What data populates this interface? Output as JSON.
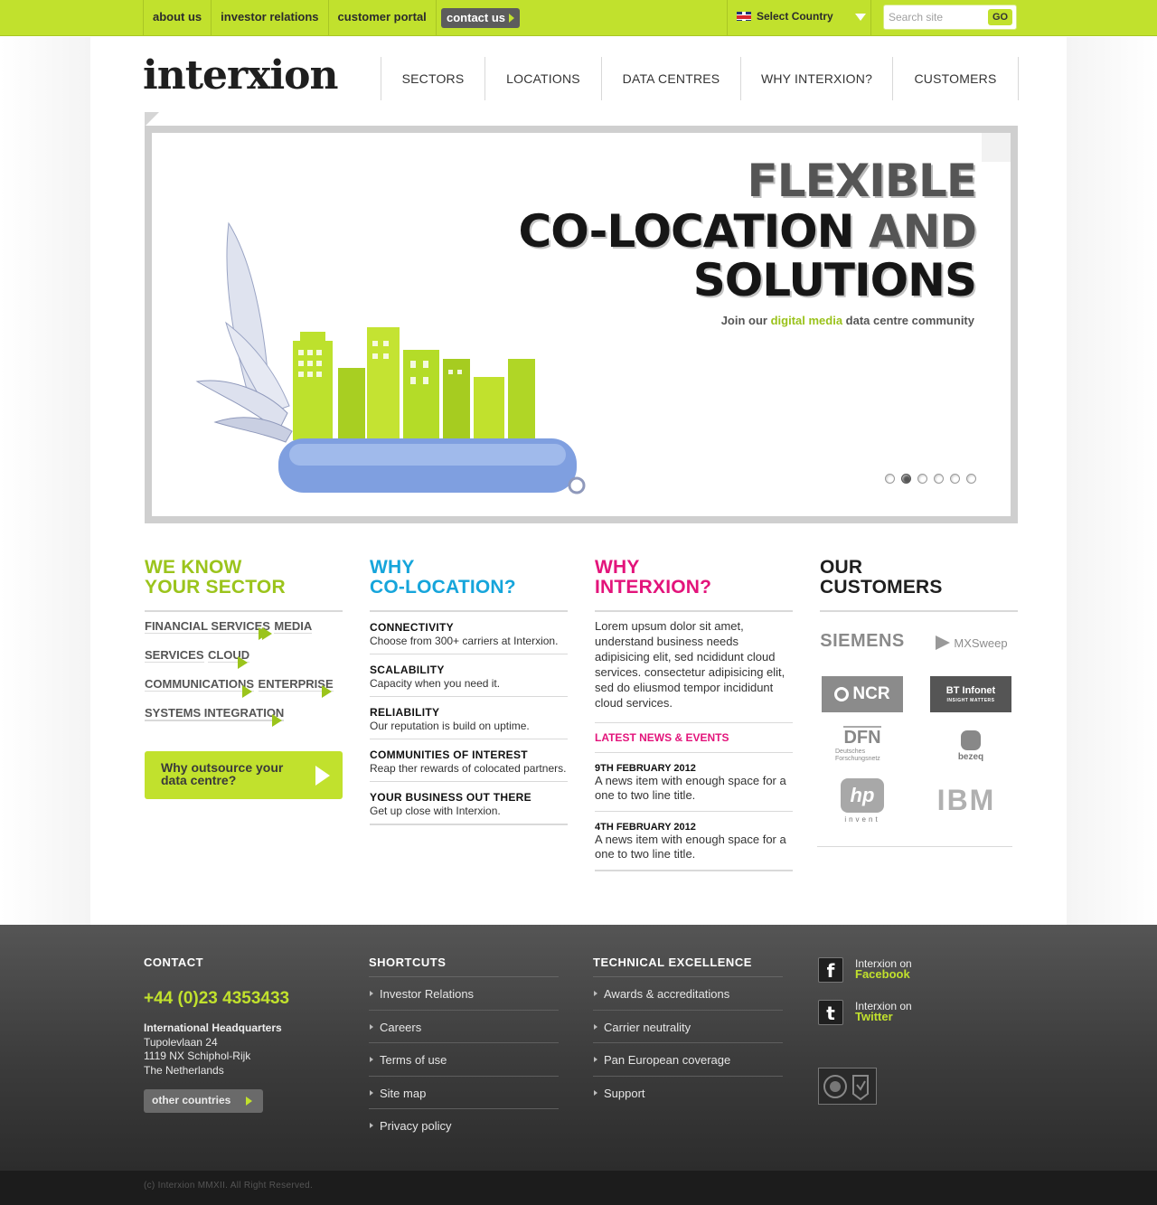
{
  "topbar": {
    "links": [
      "about us",
      "investor relations",
      "customer portal"
    ],
    "contact_label": "contact us",
    "country_label": "Select Country",
    "search_placeholder": "Search site",
    "go_label": "GO"
  },
  "brand": {
    "logo": "interxion"
  },
  "nav": [
    "SECTORS",
    "LOCATIONS",
    "DATA CENTRES",
    "WHY INTERXION?",
    "CUSTOMERS"
  ],
  "hero": {
    "line1": "FLEXIBLE",
    "line2a": "CO-LOCATION ",
    "line2b": "AND",
    "line3": "SOLUTIONS",
    "sub_pre": "Join our ",
    "sub_highlight": "digital media",
    "sub_post": " data centre community",
    "slides": 6,
    "active_slide": 2
  },
  "sector": {
    "title_1": "WE KNOW",
    "title_2": "YOUR SECTOR",
    "items": [
      "FINANCIAL SERVICES",
      "MEDIA SERVICES",
      "CLOUD",
      "COMMUNICATIONS",
      "ENTERPRISE",
      "SYSTEMS INTEGRATION"
    ],
    "cta_1": "Why outsource your",
    "cta_2": "data centre?"
  },
  "colocation": {
    "title_1": "WHY",
    "title_2": "CO-LOCATION?",
    "items": [
      {
        "title": "CONNECTIVITY",
        "text": "Choose from 300+ carriers at Interxion."
      },
      {
        "title": "SCALABILITY",
        "text": "Capacity when you need it."
      },
      {
        "title": "RELIABILITY",
        "text": "Our reputation is build on uptime."
      },
      {
        "title": "COMMUNITIES OF INTEREST",
        "text": "Reap ther rewards of colocated partners."
      },
      {
        "title": "YOUR BUSINESS OUT THERE",
        "text": "Get up close with Interxion."
      }
    ]
  },
  "interxion": {
    "title_1": "WHY",
    "title_2": "INTERXION?",
    "body": "Lorem upsum dolor sit amet, understand business needs adipisicing elit, sed ncididunt cloud services. consectetur adipisicing elit, sed do eliusmod tempor incididunt cloud services.",
    "news_heading": "LATEST NEWS & EVENTS",
    "news": [
      {
        "date": "9TH FEBRUARY 2012",
        "text": "A news item with enough space for a one to two line title."
      },
      {
        "date": "4TH FEBRUARY 2012",
        "text": "A news item with enough space for a one to two line title."
      }
    ]
  },
  "customers": {
    "title_1": "OUR",
    "title_2": "CUSTOMERS",
    "logos": {
      "siemens": "SIEMENS",
      "mxsweep": "MXSweep",
      "ncr": "NCR",
      "bt": "BT",
      "bt_sub": "Infonet",
      "bt_tag": "INSIGHT MATTERS",
      "dfn": "DFN",
      "dfn_sub": "Deutsches Forschungsnetz",
      "bezeq": "bezeq",
      "hp": "hp",
      "hp_sub": "invent",
      "ibm": "IBM"
    }
  },
  "footer": {
    "contact_heading": "CONTACT",
    "phone": "+44 (0)23 4353433",
    "hq_title": "International Headquarters",
    "hq_lines": [
      "Tupolevlaan 24",
      "1119 NX Schiphol-Rijk",
      "The Netherlands"
    ],
    "other_label": "other countries",
    "shortcuts_heading": "SHORTCUTS",
    "shortcuts": [
      "Investor Relations",
      "Careers",
      "Terms of use",
      "Site map",
      "Privacy policy"
    ],
    "tech_heading": "TECHNICAL EXCELLENCE",
    "tech": [
      "Awards & accreditations",
      "Carrier neutrality",
      "Pan European coverage",
      "Support"
    ],
    "social": [
      {
        "prefix": "Interxion on",
        "name": "Facebook",
        "icon": "facebook-icon"
      },
      {
        "prefix": "Interxion on",
        "name": "Twitter",
        "icon": "twitter-icon"
      }
    ],
    "copyright": "(c) Interxion MMXII.  All Right Reserved."
  },
  "colors": {
    "accent_green": "#c1e12d",
    "sector_green": "#9bc41c",
    "colocation_blue": "#16a5db",
    "interxion_pink": "#e3147b"
  }
}
